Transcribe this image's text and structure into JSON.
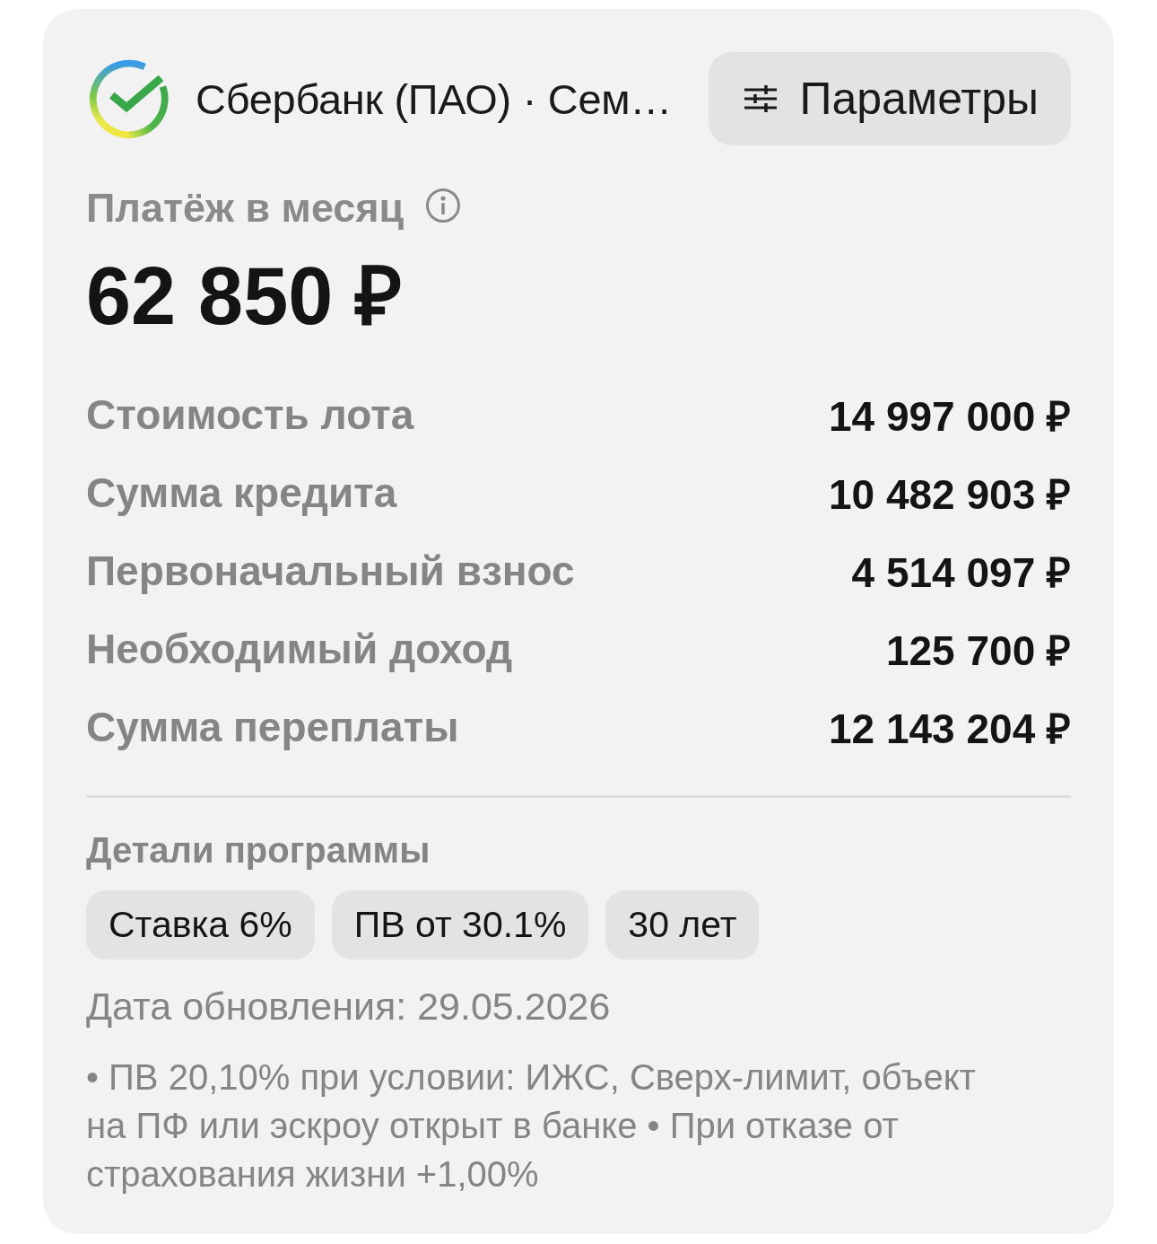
{
  "header": {
    "bank_name": "Сбербанк (ПАО) · Сем…",
    "params_button": "Параметры"
  },
  "payment": {
    "label": "Платёж в месяц",
    "amount": "62 850 ₽"
  },
  "summary": [
    {
      "label": "Стоимость лота",
      "value": "14 997 000 ₽"
    },
    {
      "label": "Сумма кредита",
      "value": "10 482 903 ₽"
    },
    {
      "label": "Первоначальный взнос",
      "value": "4 514 097 ₽"
    },
    {
      "label": "Необходимый доход",
      "value": "125 700 ₽"
    },
    {
      "label": "Сумма переплаты",
      "value": "12 143 204 ₽"
    }
  ],
  "program": {
    "title": "Детали программы",
    "chips": [
      "Ставка 6%",
      "ПВ от 30.1%",
      "30 лет"
    ],
    "updated": "Дата обновления: 29.05.2026",
    "note": "• ПВ 20,10% при условии: ИЖС, Сверх-лимит, объект на ПФ или эскроу открыт в банке • При отказе от страхования жизни +1,00%"
  }
}
